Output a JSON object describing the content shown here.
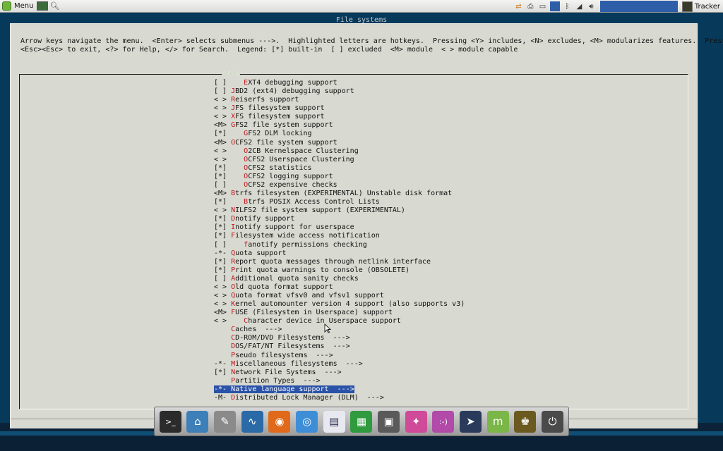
{
  "top_panel": {
    "menu_label": "Menu",
    "tracker_label": "Tracker",
    "tray_icons": [
      "network-icon",
      "printer-icon",
      "drive-icon",
      "bluetooth-icon",
      "wifi-icon",
      "volume-icon"
    ]
  },
  "terminal": {
    "screen_title": "File systems",
    "help_line_1": "Arrow keys navigate the menu.  <Enter> selects submenus --->.  Highlighted letters are hotkeys.  Pressing <Y> includes, <N> excludes, <M> modularizes features.  Press",
    "help_line_2": "<Esc><Esc> to exit, <?> for Help, </> for Search.  Legend: [*] built-in  [ ] excluded  <M> module  < > module capable",
    "box_title": "^(-)",
    "selected_index": 36,
    "items": [
      {
        "prefix": "[ ]",
        "indent": "    ",
        "hotkey": "E",
        "rest": "XT4 debugging support"
      },
      {
        "prefix": "[ ]",
        "indent": " ",
        "hotkey": "J",
        "rest": "BD2 (ext4) debugging support"
      },
      {
        "prefix": "< >",
        "indent": " ",
        "hotkey": "R",
        "rest": "eiserfs support"
      },
      {
        "prefix": "< >",
        "indent": " ",
        "hotkey": "J",
        "rest": "FS filesystem support"
      },
      {
        "prefix": "< >",
        "indent": " ",
        "hotkey": "X",
        "rest": "FS filesystem support"
      },
      {
        "prefix": "<M>",
        "indent": " ",
        "hotkey": "G",
        "rest": "FS2 file system support"
      },
      {
        "prefix": "[*]",
        "indent": "    ",
        "hotkey": "G",
        "rest": "FS2 DLM locking"
      },
      {
        "prefix": "<M>",
        "indent": " ",
        "hotkey": "O",
        "rest": "CFS2 file system support"
      },
      {
        "prefix": "< >",
        "indent": "    ",
        "hotkey": "O",
        "rest": "2CB Kernelspace Clustering"
      },
      {
        "prefix": "< >",
        "indent": "    ",
        "hotkey": "O",
        "rest": "CFS2 Userspace Clustering"
      },
      {
        "prefix": "[*]",
        "indent": "    ",
        "hotkey": "O",
        "rest": "CFS2 statistics"
      },
      {
        "prefix": "[*]",
        "indent": "    ",
        "hotkey": "O",
        "rest": "CFS2 logging support"
      },
      {
        "prefix": "[ ]",
        "indent": "    ",
        "hotkey": "O",
        "rest": "CFS2 expensive checks"
      },
      {
        "prefix": "<M>",
        "indent": " ",
        "hotkey": "B",
        "rest": "trfs filesystem (EXPERIMENTAL) Unstable disk format"
      },
      {
        "prefix": "[*]",
        "indent": "    ",
        "hotkey": "B",
        "rest": "trfs POSIX Access Control Lists"
      },
      {
        "prefix": "< >",
        "indent": " ",
        "hotkey": "N",
        "rest": "ILFS2 file system support (EXPERIMENTAL)"
      },
      {
        "prefix": "[*]",
        "indent": " ",
        "hotkey": "D",
        "rest": "notify support"
      },
      {
        "prefix": "[*]",
        "indent": " ",
        "hotkey": "I",
        "rest": "notify support for userspace"
      },
      {
        "prefix": "[*]",
        "indent": " ",
        "hotkey": "F",
        "rest": "ilesystem wide access notification"
      },
      {
        "prefix": "[ ]",
        "indent": "    ",
        "hotkey": "f",
        "rest": "anotify permissions checking"
      },
      {
        "prefix": "-*-",
        "indent": " ",
        "hotkey": "Q",
        "rest": "uota support"
      },
      {
        "prefix": "[*]",
        "indent": " ",
        "hotkey": "R",
        "rest": "eport quota messages through netlink interface"
      },
      {
        "prefix": "[*]",
        "indent": " ",
        "hotkey": "P",
        "rest": "rint quota warnings to console (OBSOLETE)"
      },
      {
        "prefix": "[ ]",
        "indent": " ",
        "hotkey": "A",
        "rest": "dditional quota sanity checks"
      },
      {
        "prefix": "< >",
        "indent": " ",
        "hotkey": "O",
        "rest": "ld quota format support"
      },
      {
        "prefix": "< >",
        "indent": " ",
        "hotkey": "Q",
        "rest": "uota format vfsv0 and vfsv1 support"
      },
      {
        "prefix": "< >",
        "indent": " ",
        "hotkey": "K",
        "rest": "ernel automounter version 4 support (also supports v3)"
      },
      {
        "prefix": "<M>",
        "indent": " ",
        "hotkey": "F",
        "rest": "USE (Filesystem in Userspace) support"
      },
      {
        "prefix": "< >",
        "indent": "    ",
        "hotkey": "C",
        "rest": "haracter device in Userspace support"
      },
      {
        "prefix": "   ",
        "indent": " ",
        "hotkey": "C",
        "rest": "aches  --->"
      },
      {
        "prefix": "   ",
        "indent": " ",
        "hotkey": "C",
        "rest": "D-ROM/DVD Filesystems  --->"
      },
      {
        "prefix": "   ",
        "indent": " ",
        "hotkey": "D",
        "rest": "OS/FAT/NT Filesystems  --->"
      },
      {
        "prefix": "   ",
        "indent": " ",
        "hotkey": "P",
        "rest": "seudo filesystems  --->"
      },
      {
        "prefix": "-*-",
        "indent": " ",
        "hotkey": "M",
        "rest": "iscellaneous filesystems  --->"
      },
      {
        "prefix": "[*]",
        "indent": " ",
        "hotkey": "N",
        "rest": "etwork File Systems  --->"
      },
      {
        "prefix": "   ",
        "indent": " ",
        "hotkey": "P",
        "rest": "artition Types  --->"
      },
      {
        "prefix": "-*-",
        "indent": " ",
        "hotkey": "N",
        "rest": "ative language support  --->"
      },
      {
        "prefix": "-M-",
        "indent": " ",
        "hotkey": "D",
        "rest": "istributed Lock Manager (DLM)  --->"
      }
    ]
  },
  "dock": {
    "items": [
      {
        "name": "terminal-icon",
        "glyph": ">_",
        "color": "#2b2b2b"
      },
      {
        "name": "network-config-icon",
        "glyph": "⌂",
        "color": "#3d7fb8"
      },
      {
        "name": "system-tools-icon",
        "glyph": "✎",
        "color": "#8a8a8a"
      },
      {
        "name": "system-monitor-icon",
        "glyph": "∿",
        "color": "#2a6aa6"
      },
      {
        "name": "firefox-icon",
        "glyph": "◉",
        "color": "#e06a1a"
      },
      {
        "name": "chromium-icon",
        "glyph": "◎",
        "color": "#3d8ed6"
      },
      {
        "name": "document-viewer-icon",
        "glyph": "▤",
        "color": "#e8e8f0"
      },
      {
        "name": "spreadsheet-icon",
        "glyph": "▦",
        "color": "#2f9a3e"
      },
      {
        "name": "calculator-icon",
        "glyph": "▣",
        "color": "#5a5a5a"
      },
      {
        "name": "color-palette-icon",
        "glyph": "✦",
        "color": "#d04a9a"
      },
      {
        "name": "pidgin-chat-icon",
        "glyph": ":-)",
        "color": "#b14aa8"
      },
      {
        "name": "pointer-app-icon",
        "glyph": "➤",
        "color": "#2a3a5a"
      },
      {
        "name": "mint-logo-icon",
        "glyph": "m",
        "color": "#7ab648"
      },
      {
        "name": "game-icon",
        "glyph": "♚",
        "color": "#6a5a20"
      },
      {
        "name": "power-icon",
        "glyph": "⏻",
        "color": "#4a4a4a"
      }
    ]
  }
}
